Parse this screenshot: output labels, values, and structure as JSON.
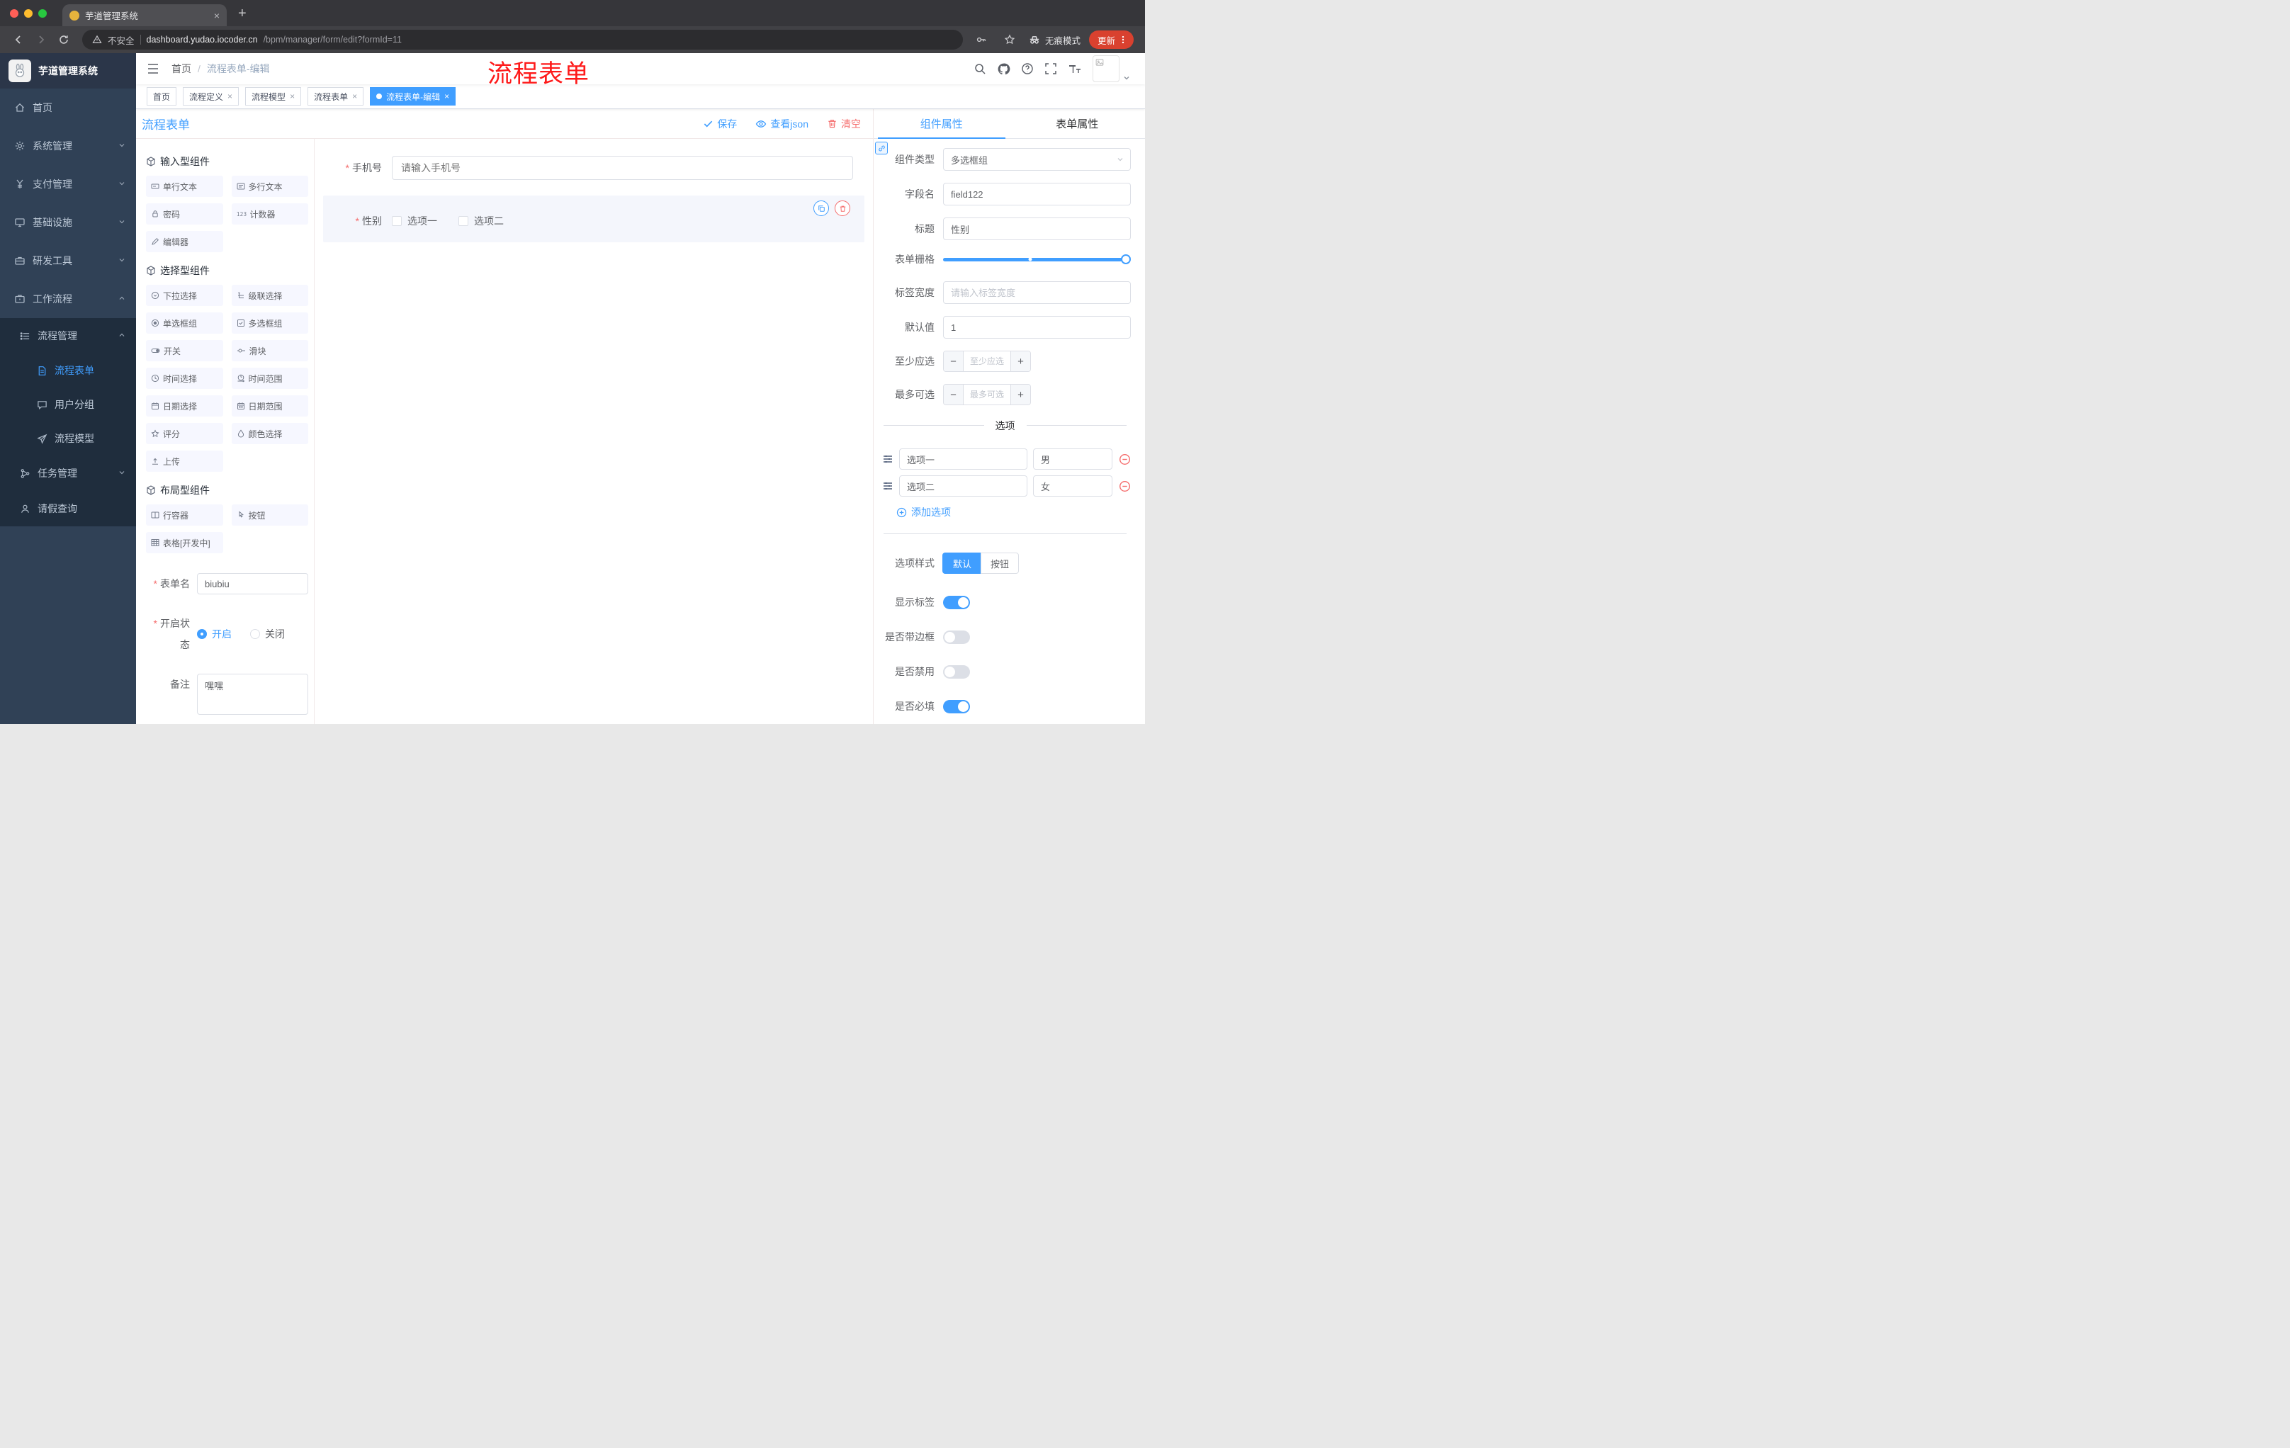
{
  "annotation": {
    "text": "流程表单"
  },
  "browser": {
    "tab_title": "芋道管理系统",
    "security_label": "不安全",
    "url_domain": "dashboard.yudao.iocoder.cn",
    "url_path": "/bpm/manager/form/edit?formId=11",
    "incognito_label": "无痕模式",
    "update_label": "更新"
  },
  "sidebar": {
    "logo_title": "芋道管理系统",
    "menu": [
      {
        "label": "首页"
      },
      {
        "label": "系统管理"
      },
      {
        "label": "支付管理"
      },
      {
        "label": "基础设施"
      },
      {
        "label": "研发工具"
      },
      {
        "label": "工作流程"
      }
    ],
    "process_mgmt": "流程管理",
    "process_children": [
      {
        "label": "流程表单"
      },
      {
        "label": "用户分组"
      },
      {
        "label": "流程模型"
      }
    ],
    "task_mgmt": "任务管理",
    "leave_query": "请假查询"
  },
  "header": {
    "breadcrumb_home": "首页",
    "breadcrumb_current": "流程表单-编辑"
  },
  "tags": [
    {
      "label": "首页",
      "closable": false,
      "active": false
    },
    {
      "label": "流程定义",
      "closable": true,
      "active": false
    },
    {
      "label": "流程模型",
      "closable": true,
      "active": false
    },
    {
      "label": "流程表单",
      "closable": true,
      "active": false
    },
    {
      "label": "流程表单-编辑",
      "closable": true,
      "active": true
    }
  ],
  "designer": {
    "title": "流程表单",
    "save": "保存",
    "view_json": "查看json",
    "clear": "清空",
    "sections": [
      {
        "title": "输入型组件",
        "items": [
          "单行文本",
          "多行文本",
          "密码",
          "计数器",
          "编辑器"
        ]
      },
      {
        "title": "选择型组件",
        "items": [
          "下拉选择",
          "级联选择",
          "单选框组",
          "多选框组",
          "开关",
          "滑块",
          "时间选择",
          "时间范围",
          "日期选择",
          "日期范围",
          "评分",
          "颜色选择",
          "上传"
        ]
      },
      {
        "title": "布局型组件",
        "items": [
          "行容器",
          "按钮",
          "表格[开发中]"
        ]
      }
    ],
    "meta": {
      "form_name_label": "表单名",
      "form_name_value": "biubiu",
      "status_label": "开启状态",
      "status_on": "开启",
      "status_off": "关闭",
      "remark_label": "备注",
      "remark_value": "嘿嘿"
    },
    "canvas": {
      "phone_label": "手机号",
      "phone_placeholder": "请输入手机号",
      "gender_label": "性别",
      "gender_options": [
        "选项一",
        "选项二"
      ]
    }
  },
  "props": {
    "tab_component": "组件属性",
    "tab_form": "表单属性",
    "component_type_label": "组件类型",
    "component_type_value": "多选框组",
    "field_name_label": "字段名",
    "field_name_value": "field122",
    "title_label": "标题",
    "title_value": "性别",
    "grid_label": "表单栅格",
    "label_width_label": "标签宽度",
    "label_width_placeholder": "请输入标签宽度",
    "default_label": "默认值",
    "default_value": "1",
    "min_select_label": "至少应选",
    "min_select_placeholder": "至少应选",
    "max_select_label": "最多可选",
    "max_select_placeholder": "最多可选",
    "options_title": "选项",
    "options": [
      {
        "label": "选项一",
        "value": "男"
      },
      {
        "label": "选项二",
        "value": "女"
      }
    ],
    "add_option": "添加选项",
    "style_label": "选项样式",
    "style_default": "默认",
    "style_button": "按钮",
    "show_label": "显示标签",
    "border_label": "是否带边框",
    "disabled_label": "是否禁用",
    "required_label": "是否必填"
  },
  "colors": {
    "primary": "#409eff",
    "danger": "#f56c6c",
    "annotation": "#fe1a1a"
  }
}
